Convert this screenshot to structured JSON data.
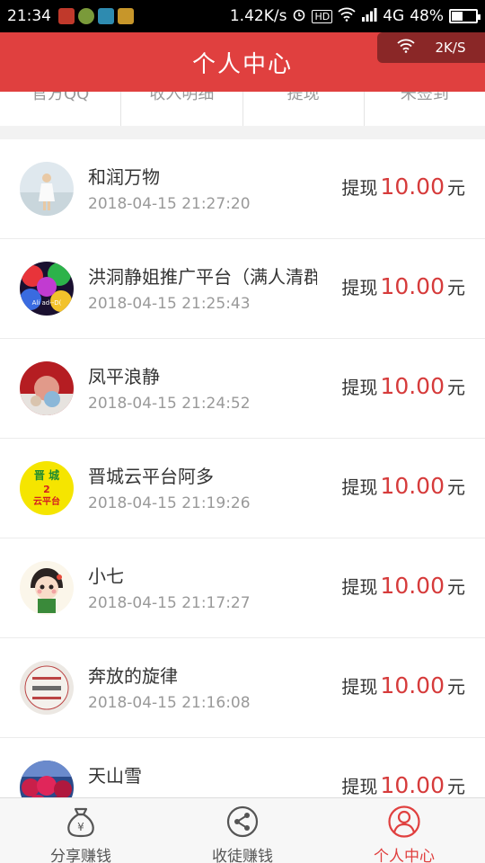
{
  "status_bar": {
    "time": "21:34",
    "network_speed": "1.42K/s",
    "hd": "HD",
    "network_type": "4G",
    "battery": "48%",
    "battery_level": 0.48
  },
  "header": {
    "title": "个人中心",
    "speed_chip": "2K/S"
  },
  "tabs": [
    "官方QQ",
    "收入明细",
    "提现",
    "未签到"
  ],
  "records": [
    {
      "name": "和润万物",
      "time": "2018-04-15 21:27:20",
      "label": "提现",
      "amount": "10.00",
      "unit": "元"
    },
    {
      "name": "洪洞静姐推广平台（满人清群",
      "time": "2018-04-15 21:25:43",
      "label": "提现",
      "amount": "10.00",
      "unit": "元"
    },
    {
      "name": "凤平浪静",
      "time": "2018-04-15 21:24:52",
      "label": "提现",
      "amount": "10.00",
      "unit": "元"
    },
    {
      "name": "晋城云平台阿多",
      "time": "2018-04-15 21:19:26",
      "label": "提现",
      "amount": "10.00",
      "unit": "元"
    },
    {
      "name": "小七",
      "time": "2018-04-15 21:17:27",
      "label": "提现",
      "amount": "10.00",
      "unit": "元"
    },
    {
      "name": "奔放的旋律",
      "time": "2018-04-15 21:16:08",
      "label": "提现",
      "amount": "10.00",
      "unit": "元"
    },
    {
      "name": "天山雪",
      "time": "",
      "label": "提现",
      "amount": "10.00",
      "unit": "元"
    }
  ],
  "avatar_texts": {
    "a2": "Ali ad--D(",
    "a4_top": "晋 城",
    "a4_mid": "2",
    "a4_bottom": "云平台"
  },
  "bottom_nav": {
    "share": {
      "label": "分享赚钱",
      "icon": "money-bag-icon"
    },
    "recruit": {
      "label": "收徒赚钱",
      "icon": "share-icon"
    },
    "profile": {
      "label": "个人中心",
      "icon": "user-icon"
    }
  },
  "colors": {
    "brand_red": "#e0403f",
    "amount_red": "#d63b3b",
    "status_bar": "#000000"
  }
}
